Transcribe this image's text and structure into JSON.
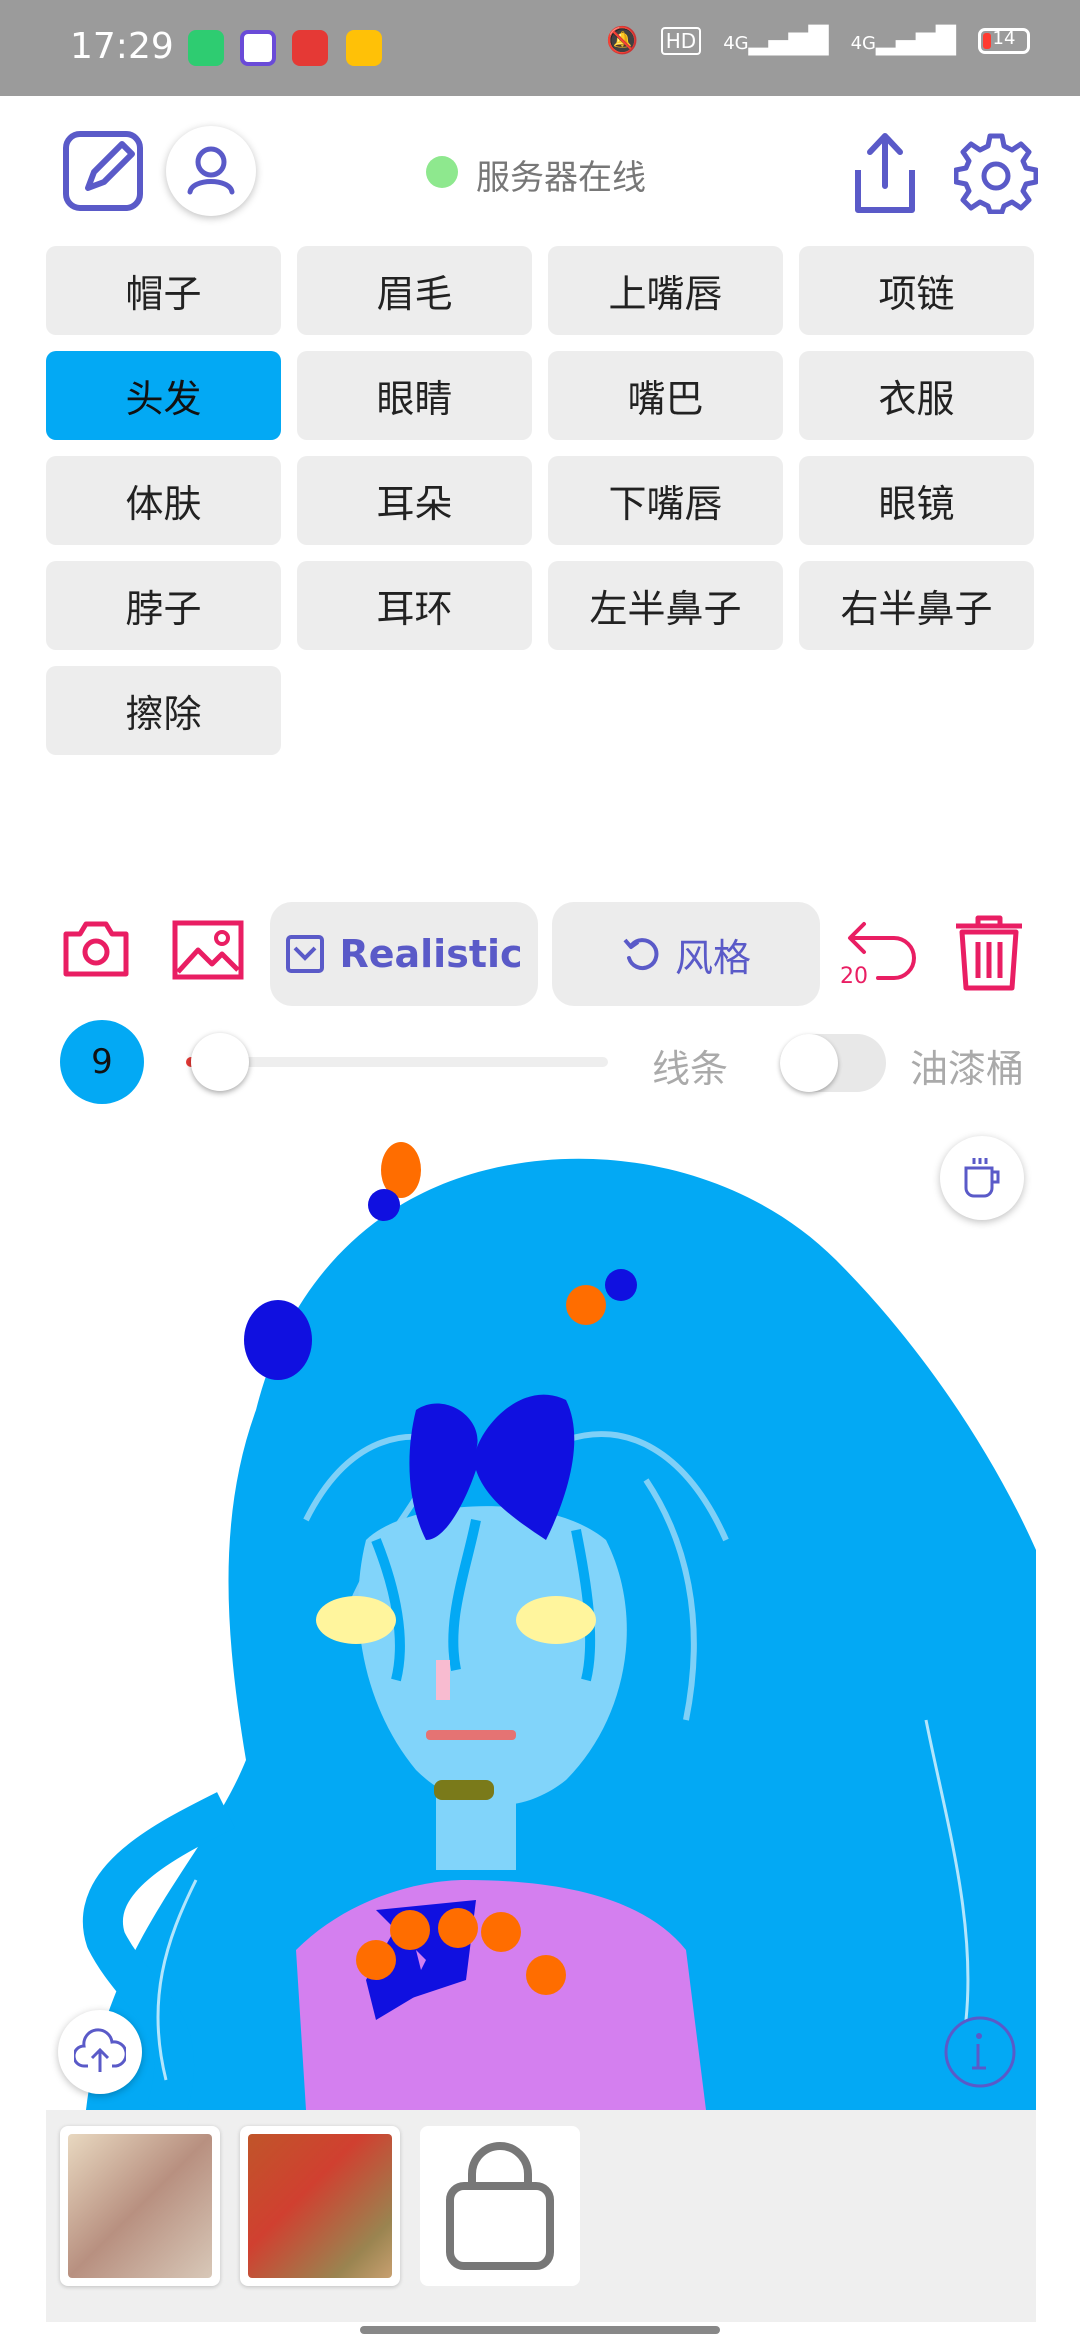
{
  "status_bar": {
    "time": "17:29",
    "battery_level": "14",
    "network_1": "4G",
    "network_2": "4G",
    "hd_label": "HD"
  },
  "header": {
    "server_status": "服务器在线"
  },
  "parts": [
    {
      "label": "帽子"
    },
    {
      "label": "眉毛"
    },
    {
      "label": "上嘴唇"
    },
    {
      "label": "项链"
    },
    {
      "label": "头发",
      "active": true
    },
    {
      "label": "眼睛"
    },
    {
      "label": "嘴巴"
    },
    {
      "label": "衣服"
    },
    {
      "label": "体肤"
    },
    {
      "label": "耳朵"
    },
    {
      "label": "下嘴唇"
    },
    {
      "label": "眼镜"
    },
    {
      "label": "脖子"
    },
    {
      "label": "耳环"
    },
    {
      "label": "左半鼻子"
    },
    {
      "label": "右半鼻子"
    },
    {
      "label": "擦除"
    }
  ],
  "toolbar": {
    "model_label": "Realistic",
    "style_label": "风格",
    "undo_count": "20"
  },
  "brush": {
    "size": "9",
    "size_fraction": 0.08,
    "line_label": "线条",
    "bucket_label": "油漆桶",
    "bucket_enabled": false
  },
  "colors": {
    "accent_blue": "#03a9f4",
    "icon_purple": "#5a5ac8",
    "icon_red": "#e91e63",
    "server_online": "#8ee88e"
  }
}
